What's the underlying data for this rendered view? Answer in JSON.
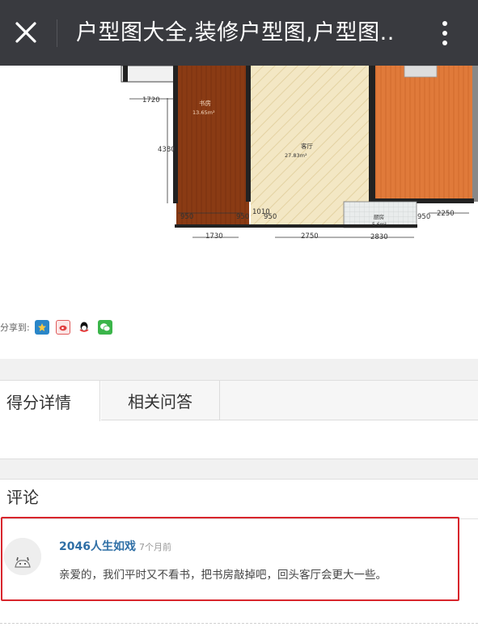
{
  "topbar": {
    "title": "户型图大全,装修户型图,户型图..",
    "close_icon": "close-icon",
    "more_icon": "more-vertical-icon",
    "background": "#393a3f"
  },
  "floorplan": {
    "rooms": {
      "study_name": "书房",
      "study_area": "13.65m²",
      "living_name": "客厅",
      "living_area": "27.83m²",
      "kitchen_name": "厨房",
      "kitchen_area": "5.6m²"
    },
    "dimensions": {
      "d1720": "1720",
      "d4380": "4380",
      "d950a": "950",
      "d950b": "950",
      "d1010": "1010",
      "d950c": "950",
      "d950d": "950",
      "d2250": "2250",
      "d1730": "1730",
      "d2750": "2750",
      "d2830": "2830"
    }
  },
  "share": {
    "label": "分享到:",
    "icons": [
      "qzone-icon",
      "weibo-icon",
      "qq-icon",
      "wechat-icon"
    ]
  },
  "tabs": [
    {
      "label": "得分详情",
      "active": true
    },
    {
      "label": "相关问答",
      "active": false
    }
  ],
  "comments": {
    "title": "评论",
    "items": [
      {
        "user": "2046人生如戏",
        "time": "7个月前",
        "text": "亲爱的，我们平时又不看书，把书房敲掉吧，回头客厅会更大一些。"
      }
    ],
    "highlight_color": "#d8252c"
  }
}
